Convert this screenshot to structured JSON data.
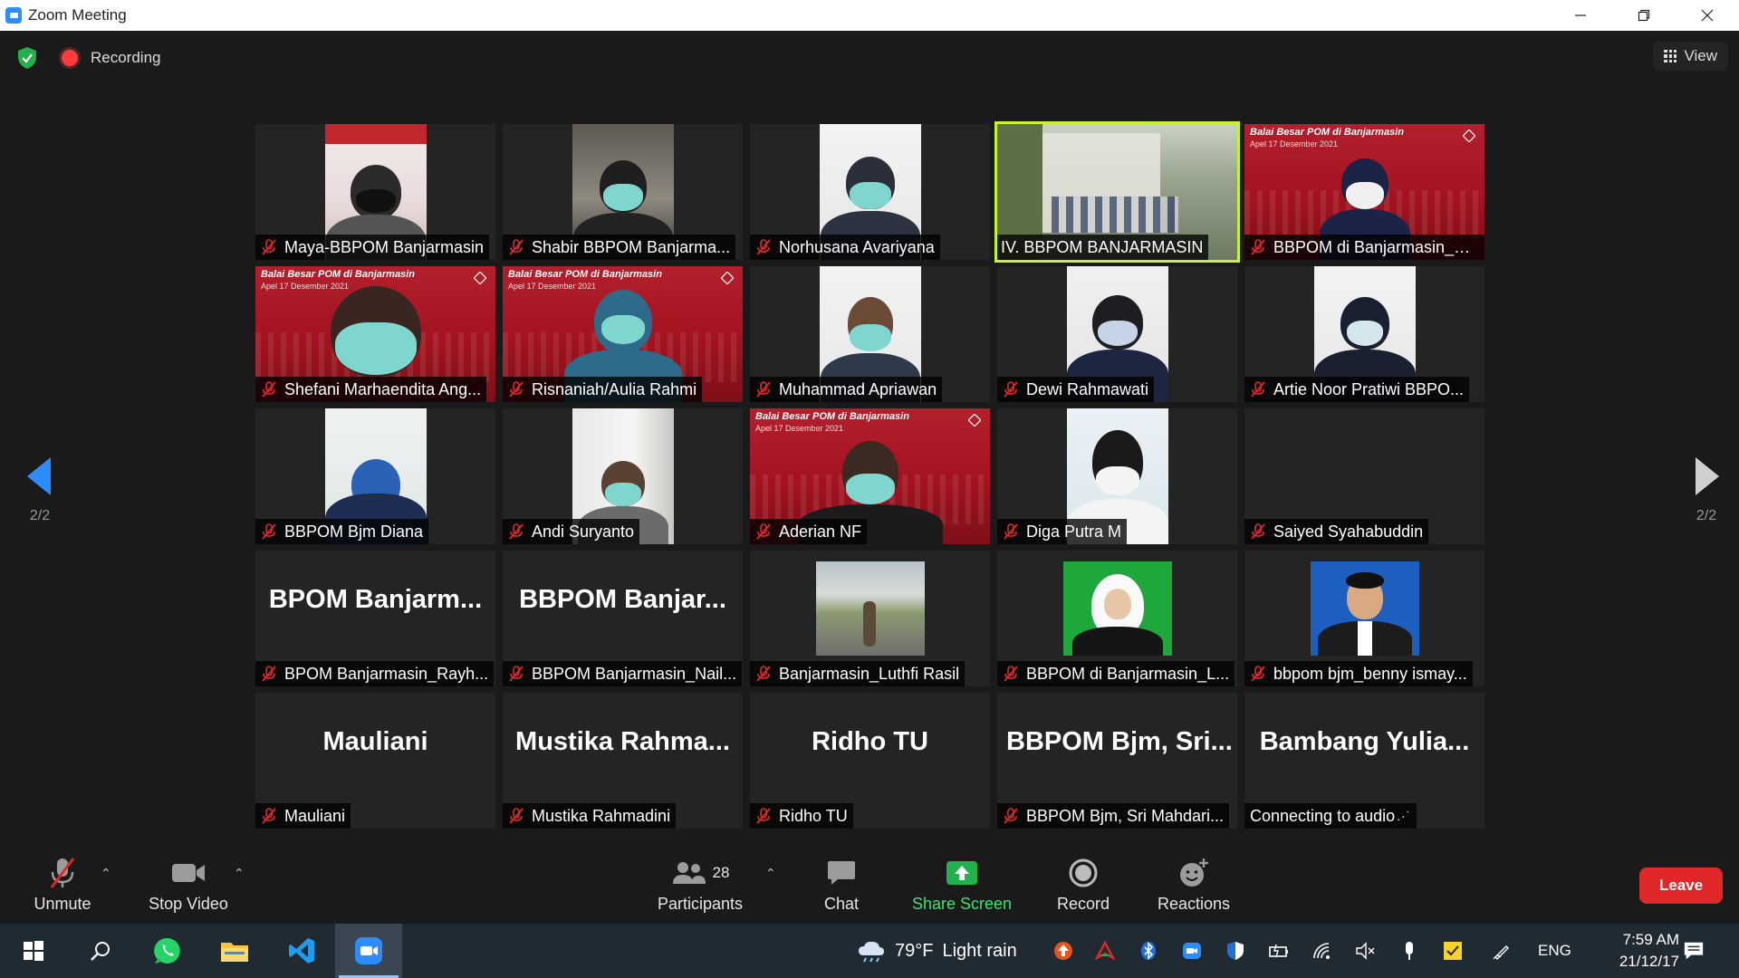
{
  "window": {
    "title": "Zoom Meeting",
    "controls": [
      "minimize",
      "restore",
      "close"
    ]
  },
  "topbar": {
    "recording_label": "Recording",
    "view_label": "View"
  },
  "navigation": {
    "left_page": "2/2",
    "right_page": "2/2"
  },
  "participants": [
    {
      "name": "Maya-BBPOM Banjarmasin",
      "muted": true,
      "type": "video"
    },
    {
      "name": "Shabir BBPOM Banjarma...",
      "muted": true,
      "type": "video"
    },
    {
      "name": "Norhusana Avariyana",
      "muted": true,
      "type": "video"
    },
    {
      "name": "IV. BBPOM BANJARMASIN",
      "muted": false,
      "type": "video",
      "active_speaker": true
    },
    {
      "name": "BBPOM di Banjarmasin_U...",
      "muted": true,
      "type": "video"
    },
    {
      "name": "Shefani Marhaendita Ang...",
      "muted": true,
      "type": "video"
    },
    {
      "name": "Risnaniah/Aulia Rahmi",
      "muted": true,
      "type": "video"
    },
    {
      "name": "Muhammad Apriawan",
      "muted": true,
      "type": "video"
    },
    {
      "name": "Dewi Rahmawati",
      "muted": true,
      "type": "video"
    },
    {
      "name": "Artie Noor Pratiwi BBPO...",
      "muted": true,
      "type": "video"
    },
    {
      "name": "BBPOM Bjm Diana",
      "muted": true,
      "type": "video"
    },
    {
      "name": "Andi Suryanto",
      "muted": true,
      "type": "video"
    },
    {
      "name": "Aderian NF",
      "muted": true,
      "type": "video"
    },
    {
      "name": "Diga Putra M",
      "muted": true,
      "type": "video"
    },
    {
      "name": "Saiyed Syahabuddin",
      "muted": true,
      "type": "blank"
    },
    {
      "name": "BPOM Banjarmasin_Rayh...",
      "display": "BPOM  Banjarm...",
      "muted": true,
      "type": "name"
    },
    {
      "name": "BBPOM Banjarmasin_Nail...",
      "display": "BBPOM  Banjar...",
      "muted": true,
      "type": "name"
    },
    {
      "name": "Banjarmasin_Luthfi Rasil",
      "muted": true,
      "type": "photo"
    },
    {
      "name": "BBPOM di Banjarmasin_L...",
      "muted": true,
      "type": "photo"
    },
    {
      "name": "bbpom bjm_benny ismay...",
      "muted": true,
      "type": "photo"
    },
    {
      "name": "Mauliani",
      "display": "Mauliani",
      "muted": true,
      "type": "name"
    },
    {
      "name": "Mustika Rahmadini",
      "display": "Mustika  Rahma...",
      "muted": true,
      "type": "name"
    },
    {
      "name": "Ridho TU",
      "display": "Ridho TU",
      "muted": true,
      "type": "name"
    },
    {
      "name": "BBPOM Bjm, Sri Mahdari...",
      "display": "BBPOM  Bjm,  Sri...",
      "muted": true,
      "type": "name"
    },
    {
      "name": "Connecting to audio ",
      "display": "Bambang  Yulia...",
      "muted": false,
      "type": "name",
      "status_icon": "connecting-icon"
    }
  ],
  "slide": {
    "title": "Balai Besar POM di Banjarmasin",
    "subtitle": "Apel 17 Desember 2021"
  },
  "toolbar": {
    "unmute": "Unmute",
    "stop_video": "Stop Video",
    "participants_label": "Participants",
    "participants_count": "28",
    "chat": "Chat",
    "share_screen": "Share Screen",
    "record": "Record",
    "reactions": "Reactions",
    "leave": "Leave"
  },
  "taskbar": {
    "weather_temp": "79°F",
    "weather_desc": "Light rain",
    "language": "ENG",
    "time": "7:59 AM",
    "date": "21/12/17",
    "apps": [
      "windows-start-icon",
      "search-icon",
      "whatsapp-icon",
      "file-explorer-icon",
      "vscode-icon",
      "zoom-icon"
    ]
  },
  "colors": {
    "accent": "#2d8cff",
    "active_speaker": "#c9f227",
    "leave": "#e02828",
    "share": "#3ee07a",
    "muted_icon": "#e02828"
  }
}
